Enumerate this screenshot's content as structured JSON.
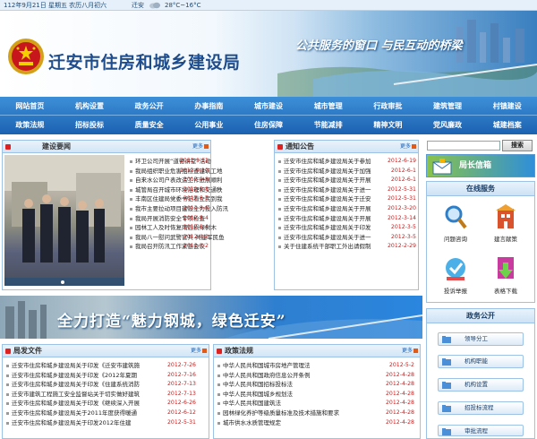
{
  "topbar": {
    "date": "112年9月21日 星期五 农历八月初六",
    "city": "迁安",
    "temperature": "28°C~16°C"
  },
  "header": {
    "site_title": "迁安市住房和城乡建设局",
    "slogan": "公共服务的窗口   与民互动的桥梁"
  },
  "nav": {
    "row1": [
      "网站首页",
      "机构设置",
      "政务公开",
      "办事指南",
      "城市建设",
      "城市管理",
      "行政审批",
      "建筑管理",
      "村镇建设"
    ],
    "row2": [
      "政策法规",
      "招标投标",
      "质量安全",
      "公用事业",
      "住房保障",
      "节能减排",
      "精神文明",
      "党风廉政",
      "城建档案"
    ]
  },
  "news": {
    "title": "建设要闻",
    "more": "更多",
    "items": [
      {
        "title": "环卫公司开展“道德讲堂”活动",
        "date": "2012-9-13"
      },
      {
        "title": "我局组织职业危害组检查建筑工地",
        "date": "2012-9-10"
      },
      {
        "title": "自来水公司户表改造工作进展顺利",
        "date": "2012-9-8"
      },
      {
        "title": "城管局召开城市环境治理和交通秩",
        "date": "2012-9-8"
      },
      {
        "title": "丰南区住建局党委书记看立民到我",
        "date": "2012-8-7"
      },
      {
        "title": "我市主要拉动项目建设全力投入防汛",
        "date": "2012-8-6"
      },
      {
        "title": "我局开展消防安全专项检查",
        "date": "2012-8-4"
      },
      {
        "title": "园林工人及时恢复雨后损绿树木",
        "date": "2012-8-4"
      },
      {
        "title": "我局八一慰问武警官兵 共建军民鱼",
        "date": "2012-8-2"
      },
      {
        "title": "我局召开防汛工作紧急会议",
        "date": "2012-8-2"
      }
    ]
  },
  "notices": {
    "title": "通知公告",
    "more": "更多",
    "items": [
      {
        "title": "迁安市住房和城乡建设局关于参加",
        "date": "2012-6-19"
      },
      {
        "title": "迁安市住房和城乡建设局关于加强",
        "date": "2012-6-1"
      },
      {
        "title": "迁安市住房和城乡建设局关于开展",
        "date": "2012-6-1"
      },
      {
        "title": "迁安市住房和城乡建设局关于进一",
        "date": "2012-5-31"
      },
      {
        "title": "迁安市住房和城乡建设局关于迁安",
        "date": "2012-5-31"
      },
      {
        "title": "迁安市住房和城乡建设局关于开展",
        "date": "2012-3-20"
      },
      {
        "title": "迁安市住房和城乡建设局关于开展",
        "date": "2012-3-14"
      },
      {
        "title": "迁安市住房和城乡建设局关于印发",
        "date": "2012-3-5"
      },
      {
        "title": "迁安市住房和城乡建设局关于进一",
        "date": "2012-3-5"
      },
      {
        "title": "关于住建系统干部职工外出请假制",
        "date": "2012-2-29"
      }
    ]
  },
  "banner": {
    "text": "全力打造“魅力钢城，绿色迁安”"
  },
  "documents": {
    "title": "局发文件",
    "more": "更多",
    "items": [
      {
        "title": "迁安市住房和城乡建设局关于印发《迁安市建筑施",
        "date": "2012-7-26"
      },
      {
        "title": "迁安市住房和城乡建设局关于印发《2012年夏期",
        "date": "2012-7-16"
      },
      {
        "title": "迁安市住房和城乡建设局关于印发《住建系统消防",
        "date": "2012-7-13"
      },
      {
        "title": "迁安市建筑工程施工安全监督站关于切实做好建筑",
        "date": "2012-7-13"
      },
      {
        "title": "迁安市住房和城乡建设局关于印发《继续深入开展",
        "date": "2012-6-26"
      },
      {
        "title": "迁安市住房和城乡建设局关于2011年度获得暖通",
        "date": "2012-6-12"
      },
      {
        "title": "迁安市住房和城乡建设局关于印发2012年住建",
        "date": "2012-5-31"
      }
    ]
  },
  "policies": {
    "title": "政策法规",
    "more": "更多",
    "items": [
      {
        "title": "中华人民共和国城市房地产管理法",
        "date": "2012-5-2"
      },
      {
        "title": "中华人民共和国政府信息公开条例",
        "date": "2012-4-28"
      },
      {
        "title": "中华人民共和国招标投标法",
        "date": "2012-4-28"
      },
      {
        "title": "中华人民共和国城乡规划法",
        "date": "2012-4-28"
      },
      {
        "title": "中华人民共和国建筑法",
        "date": "2012-4-28"
      },
      {
        "title": "园林绿化养护等级质量标准及技术措施和要求",
        "date": "2012-4-28"
      },
      {
        "title": "城市供水水质管理规定",
        "date": "2012-4-28"
      }
    ]
  },
  "sidebar": {
    "search_label": "搜索",
    "mayor_mailbox": "局长信箱",
    "online_service": {
      "title": "在线服务",
      "items": [
        "问题咨询",
        "建言献策",
        "投诉举报",
        "表格下载"
      ]
    },
    "gov_public": {
      "title": "政务公开",
      "items": [
        "领导分工",
        "机构职能",
        "机构设置",
        "招投标流程",
        "审批流程"
      ]
    }
  },
  "colors": {
    "nav": "#1c62b2",
    "date": "#d01818",
    "accent": "#2f8fd8"
  }
}
